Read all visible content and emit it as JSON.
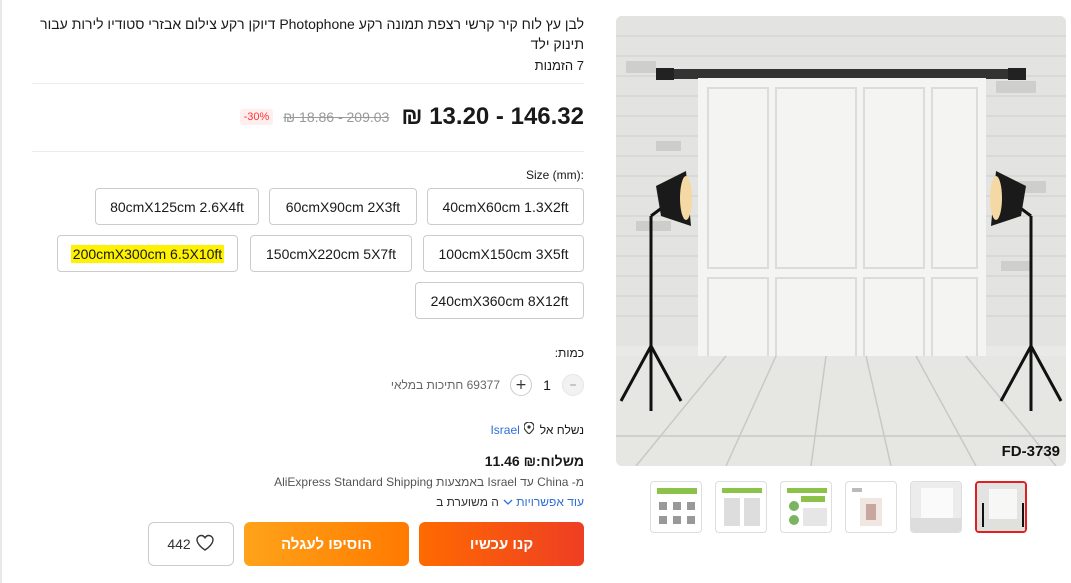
{
  "product": {
    "title": "לבן עץ לוח קיר קרשי רצפת תמונה רקע Photophone דיוקן רקע צילום אבזרי סטודיו לירות עבור תינוק ילד",
    "orders": "7 הזמנות",
    "price": "₪ 13.20 - 146.32",
    "original_price": "₪ 18.86 - 209.03",
    "discount": "-30%",
    "model_tag": "FD-3739"
  },
  "size": {
    "label": "Size (mm):",
    "options": [
      "40cmX60cm 1.3X2ft",
      "60cmX90cm 2X3ft",
      "80cmX125cm 2.6X4ft",
      "100cmX150cm 3X5ft",
      "150cmX220cm 5X7ft",
      "200cmX300cm 6.5X10ft",
      "240cmX360cm 8X12ft"
    ],
    "selected": "200cmX300cm 6.5X10ft"
  },
  "quantity": {
    "label": "כמות:",
    "value": "1",
    "stock": "69377 חתיכות במלאי"
  },
  "shipping": {
    "ship_to_label": "נשלח אל",
    "country": "Israel",
    "cost": "משלוח:₪ 11.46",
    "description": "מ- China עד Israel באמצעות AliExpress Standard Shipping",
    "more_options": "עוד אפשרויות",
    "estimated": "ה משוערת ב"
  },
  "actions": {
    "buy_now": "קנו עכשיו",
    "add_to_cart": "הוסיפו לעגלה",
    "wishlist_count": "442"
  },
  "colors": {
    "accent": "#ff4747",
    "link": "#2e6fd8",
    "highlight": "#fff200"
  },
  "icons": {
    "location": "location-pin-icon",
    "heart": "heart-icon",
    "chevron": "chevron-down-icon",
    "minus": "minus-icon",
    "plus": "plus-icon"
  }
}
